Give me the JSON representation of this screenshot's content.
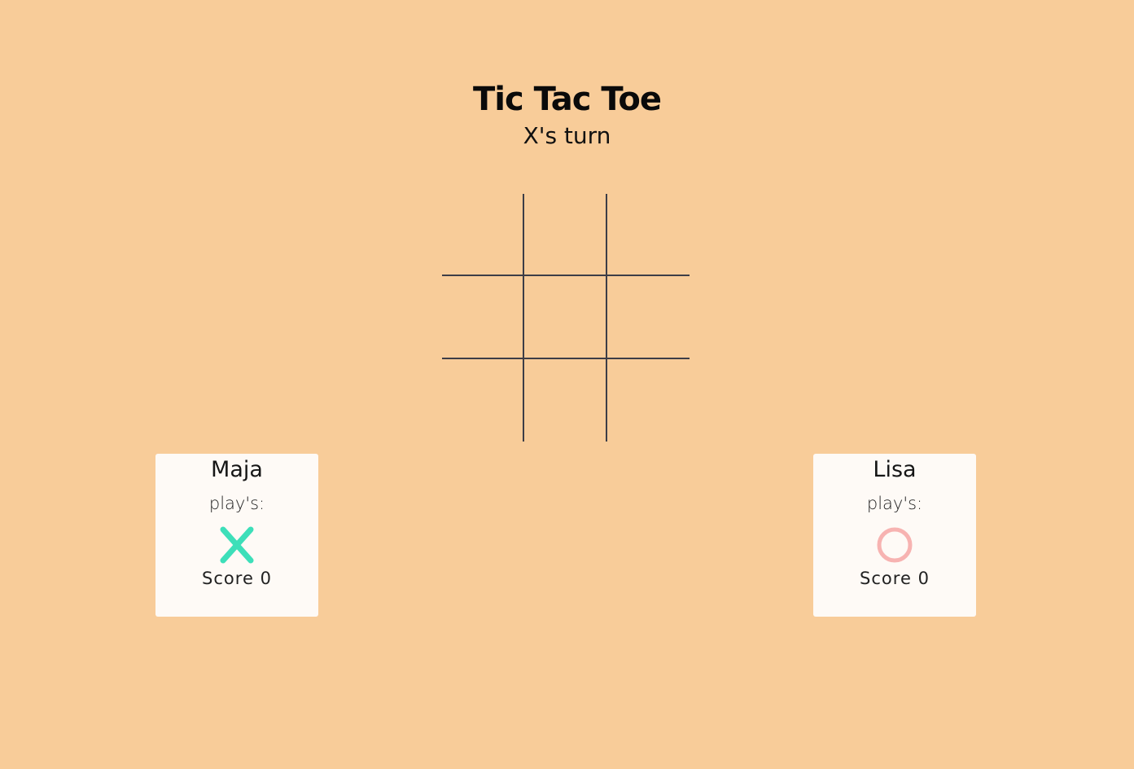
{
  "header": {
    "title": "Tic Tac Toe",
    "turn_status": "X's turn"
  },
  "board": {
    "cells": [
      "",
      "",
      "",
      "",
      "",
      "",
      "",
      "",
      ""
    ]
  },
  "players": [
    {
      "name": "Maja",
      "plays_label": "play's:",
      "symbol": "x-icon",
      "score_label": "Score",
      "score": "0",
      "symbol_color": "#3ddfb9"
    },
    {
      "name": "Lisa",
      "plays_label": "play's:",
      "symbol": "circle-icon",
      "score_label": "Score",
      "score": "0",
      "symbol_color": "#f7b3b1"
    }
  ],
  "colors": {
    "background": "#f8cc99",
    "card": "#fefaf6",
    "grid_line": "#3d3d47"
  }
}
